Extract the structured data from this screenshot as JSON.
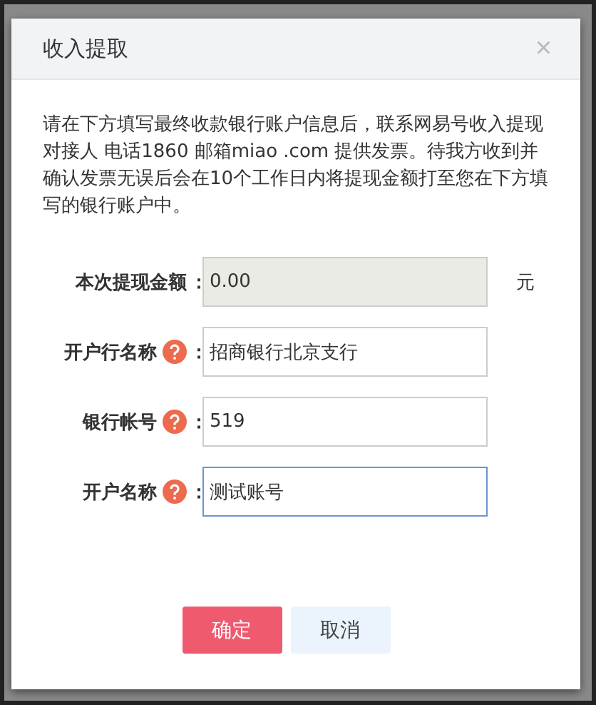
{
  "dialog": {
    "title": "收入提取",
    "close": "×"
  },
  "notice": "请在下方填写最终收款银行账户信息后，联系网易号收入提现对接人 电话1860 邮箱miao .com 提供发票。待我方收到并确认发票无误后会在10个工作日内将提现金额打至您在下方填写的银行账户中。",
  "fields": [
    {
      "label": "本次提现金额",
      "separator": "：",
      "help": false,
      "value": "0.00",
      "unit": "元",
      "disabled": true,
      "focused": false
    },
    {
      "label": "开户行名称",
      "separator": "：",
      "help": true,
      "value": "招商银行北京支行",
      "disabled": false,
      "focused": false
    },
    {
      "label": "银行帐号",
      "separator": "：",
      "help": true,
      "value": "519",
      "disabled": false,
      "focused": false
    },
    {
      "label": "开户名称",
      "separator": "：",
      "help": true,
      "value": "测试账号",
      "disabled": false,
      "focused": true
    }
  ],
  "buttons": [
    {
      "label": "确定",
      "kind": "primary"
    },
    {
      "label": "取消",
      "kind": "secondary"
    }
  ]
}
